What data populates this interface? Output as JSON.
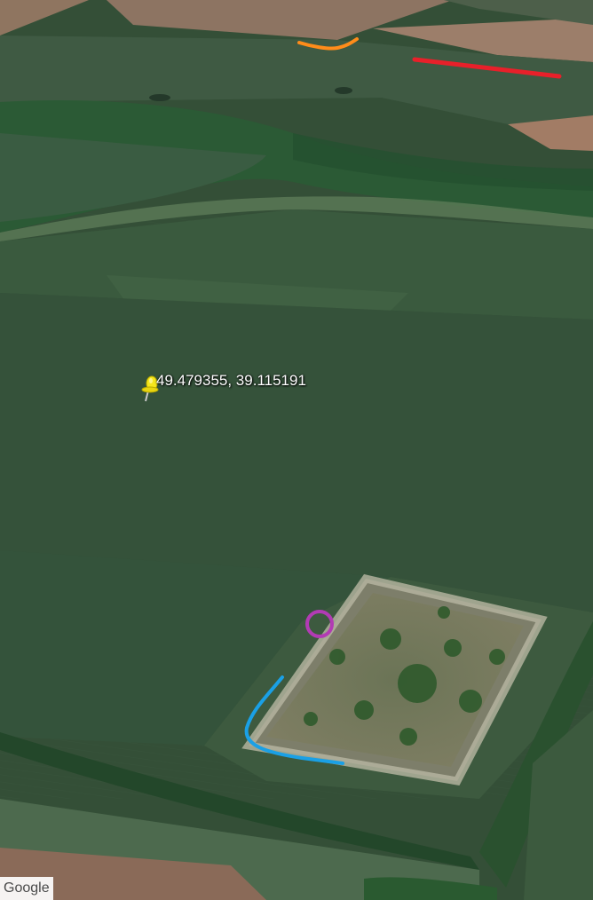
{
  "placemark": {
    "label": "49.479355, 39.115191",
    "icon": "yellow-pushpin-icon",
    "color": "#f5e61c"
  },
  "annotations": [
    {
      "name": "orange-line",
      "color": "#ff8c1a"
    },
    {
      "name": "red-line",
      "color": "#e8202a"
    },
    {
      "name": "purple-circle",
      "color": "#b23bb4"
    },
    {
      "name": "blue-curve",
      "color": "#1aa0e6"
    }
  ],
  "attribution": {
    "logo_text": "Google"
  }
}
